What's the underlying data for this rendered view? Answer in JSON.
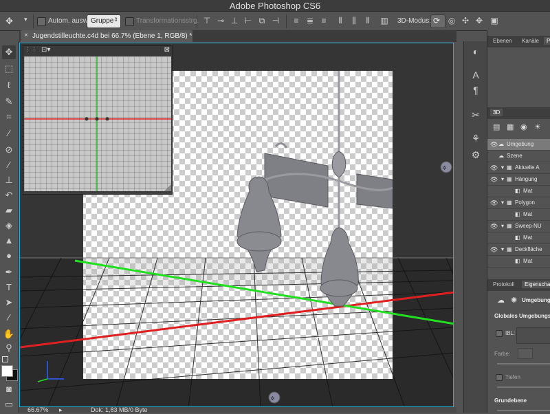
{
  "window": {
    "title": "Adobe Photoshop CS6"
  },
  "options": {
    "auto_select_label": "Autom. ausw.:",
    "auto_select_value": "Gruppe",
    "transform_label": "Transformationsstrg.",
    "mode_label": "3D-Modus:"
  },
  "document": {
    "tab_title": "Jugendstilleuchte.c4d bei 66.7% (Ebene 1, RGB/8) *",
    "zoom": "66.67%",
    "doc_info": "Dok: 1,83 MB/0 Byte"
  },
  "panels": {
    "top_tabs": [
      "Ebenen",
      "Kanäle",
      "P"
    ],
    "three_d_tab": "3D",
    "props_tabs": [
      "Protokoll",
      "Eigenscha"
    ],
    "props_title": "Umgebung",
    "global_env": "Globales Umgebungsli",
    "ibl_label": "IBL:",
    "color_label": "Farbe:",
    "depth_label": "Tiefen",
    "ground_label": "Grundebene"
  },
  "scene_rows": [
    {
      "label": "Umgebung",
      "indent": 0,
      "selected": true,
      "eye": true
    },
    {
      "label": "Szene",
      "indent": 0,
      "selected": false,
      "eye": false
    },
    {
      "label": "Aktuelle A",
      "indent": 1,
      "selected": false,
      "eye": true
    },
    {
      "label": "Hängung",
      "indent": 1,
      "selected": false,
      "eye": true
    },
    {
      "label": "Mat",
      "indent": 2,
      "selected": false,
      "eye": false
    },
    {
      "label": "Polygon",
      "indent": 1,
      "selected": false,
      "eye": true
    },
    {
      "label": "Mat",
      "indent": 2,
      "selected": false,
      "eye": false
    },
    {
      "label": "Sweep-NU",
      "indent": 1,
      "selected": false,
      "eye": true
    },
    {
      "label": "Mat",
      "indent": 2,
      "selected": false,
      "eye": false
    },
    {
      "label": "Deckfläche",
      "indent": 1,
      "selected": false,
      "eye": true
    },
    {
      "label": "Mat",
      "indent": 2,
      "selected": false,
      "eye": false
    }
  ],
  "colors": {
    "accent": "#1bb0d8",
    "selected_row": "#7a7a7a",
    "axis_red": "#e02020",
    "axis_green": "#20e020"
  }
}
